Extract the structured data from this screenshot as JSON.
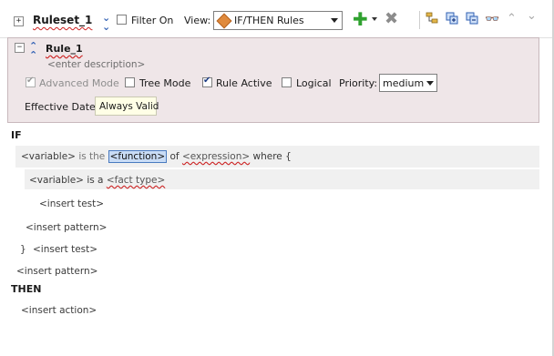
{
  "toolbar": {
    "ruleset_name": "Ruleset_1",
    "filter_label": "Filter On",
    "view_label": "View:",
    "view_value": "IF/THEN Rules"
  },
  "rule": {
    "name": "Rule_1",
    "description_placeholder": "<enter description>",
    "advanced_mode_label": "Advanced Mode",
    "tree_mode_label": "Tree Mode",
    "rule_active_label": "Rule Active",
    "logical_label": "Logical",
    "priority_label": "Priority:",
    "priority_value": "medium",
    "effective_date_label": "Effective Date:",
    "effective_date_value": "Always Valid"
  },
  "body": {
    "if_keyword": "IF",
    "then_keyword": "THEN",
    "line1": {
      "variable": "<variable>",
      "is_the": "is the",
      "function": "<function>",
      "of": "of",
      "expression": "<expression>",
      "where": "where {"
    },
    "line2": {
      "variable": "<variable>",
      "is_a": "is a",
      "fact_type": "<fact type>"
    },
    "insert_test_1": "<insert test>",
    "insert_pattern_1": "<insert pattern>",
    "close_brace": "}",
    "insert_test_2": "<insert test>",
    "insert_pattern_2": "<insert pattern>",
    "insert_action": "<insert action>"
  },
  "colors": {
    "panel_bg": "#efe6e8",
    "selection": "#c9dcf5",
    "spell_underline": "#cc2222",
    "add_green": "#2fa12f"
  }
}
